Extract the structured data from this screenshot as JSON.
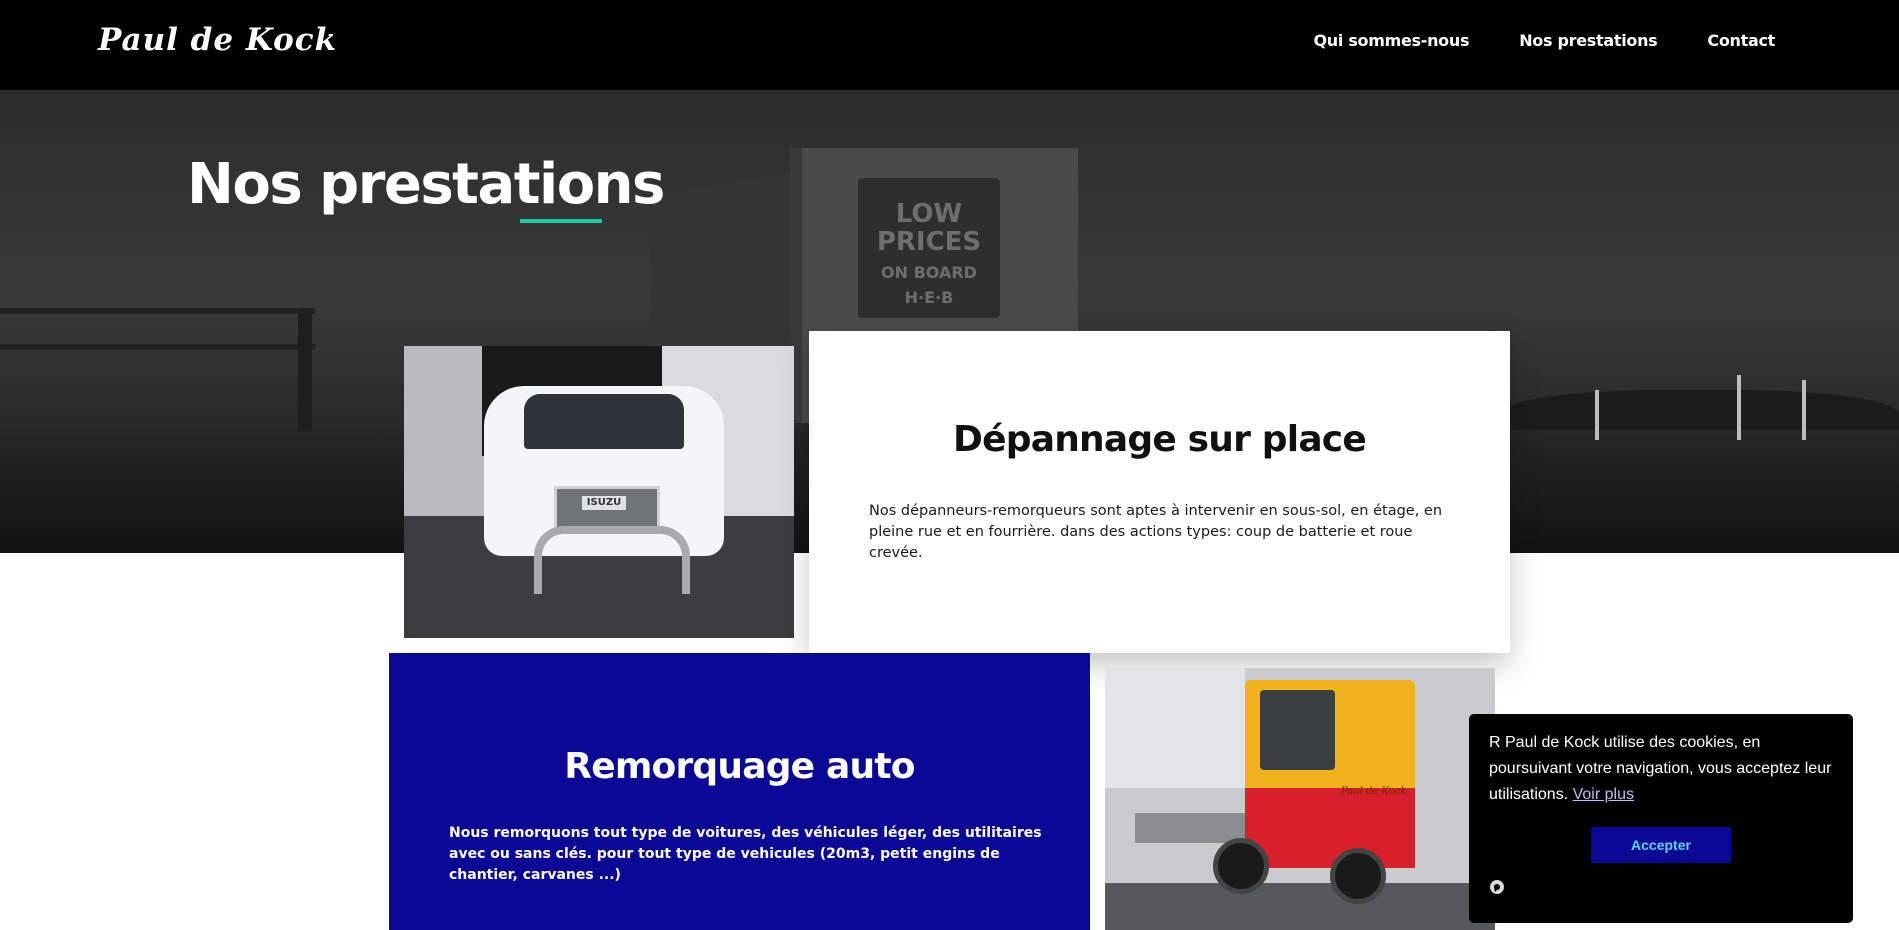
{
  "header": {
    "logo": "Paul de Kock",
    "nav": [
      {
        "label": "Qui sommes-nous"
      },
      {
        "label": "Nos prestations"
      },
      {
        "label": "Contact"
      }
    ]
  },
  "hero": {
    "title": "Nos prestations",
    "accent_color": "#1ec9a6",
    "background_sign": {
      "line1": "LOW",
      "line2": "PRICES",
      "line3": "ON BOARD",
      "brand": "H·E·B"
    }
  },
  "services": [
    {
      "title": "Dépannage sur place",
      "text": "Nos dépanneurs-remorqueurs sont aptes à intervenir en sous-sol, en étage, en pleine rue et en fourrière. dans des actions types: coup de batterie et roue crevée.",
      "photo_badge": "ISUZU",
      "background": "#ffffff"
    },
    {
      "title": "Remorquage auto",
      "text": "Nous remorquons tout type de voitures, des véhicules léger, des utilitaires avec ou sans clés. pour tout type de vehicules (20m3, petit engins de chantier, carvanes ...)",
      "photo_text": "Paul de Kock",
      "background": "#0b0896"
    }
  ],
  "cookie_banner": {
    "text": "R Paul de Kock utilise des cookies, en poursuivant votre navigation, vous acceptez leur utilisations.",
    "link_label": "Voir plus",
    "accept_label": "Accepter",
    "button_color": "#0b0896",
    "button_text_color": "#58d9f0",
    "icon": "privacy-settings-icon"
  }
}
